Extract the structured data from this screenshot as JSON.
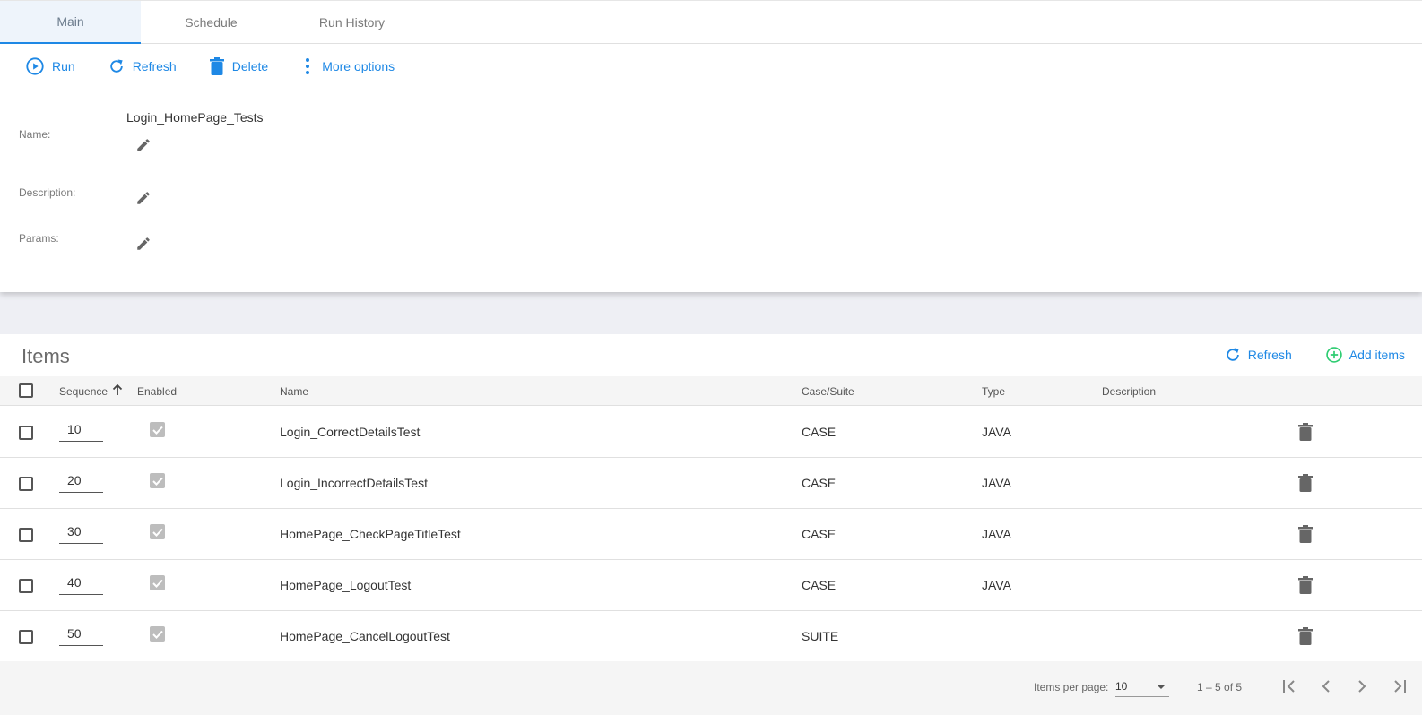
{
  "tabs": [
    {
      "label": "Main"
    },
    {
      "label": "Schedule"
    },
    {
      "label": "Run History"
    }
  ],
  "toolbar": {
    "run_label": "Run",
    "refresh_label": "Refresh",
    "delete_label": "Delete",
    "more_label": "More options"
  },
  "details": {
    "name_label": "Name:",
    "name_value": "Login_HomePage_Tests",
    "description_label": "Description:",
    "params_label": "Params:"
  },
  "items": {
    "title": "Items",
    "refresh_label": "Refresh",
    "add_label": "Add items",
    "columns": {
      "sequence": "Sequence",
      "enabled": "Enabled",
      "name": "Name",
      "case_suite": "Case/Suite",
      "type": "Type",
      "description": "Description"
    },
    "rows": [
      {
        "sequence": "10",
        "enabled": true,
        "name": "Login_CorrectDetailsTest",
        "case_suite": "CASE",
        "type": "JAVA",
        "description": ""
      },
      {
        "sequence": "20",
        "enabled": true,
        "name": "Login_IncorrectDetailsTest",
        "case_suite": "CASE",
        "type": "JAVA",
        "description": ""
      },
      {
        "sequence": "30",
        "enabled": true,
        "name": "HomePage_CheckPageTitleTest",
        "case_suite": "CASE",
        "type": "JAVA",
        "description": ""
      },
      {
        "sequence": "40",
        "enabled": true,
        "name": "HomePage_LogoutTest",
        "case_suite": "CASE",
        "type": "JAVA",
        "description": ""
      },
      {
        "sequence": "50",
        "enabled": true,
        "name": "HomePage_CancelLogoutTest",
        "case_suite": "SUITE",
        "type": "",
        "description": ""
      }
    ]
  },
  "paginator": {
    "items_per_page_label": "Items per page:",
    "items_per_page_value": "10",
    "range_label": "1 – 5 of 5"
  },
  "colors": {
    "accent": "#1e88e5",
    "add_green": "#2ecc71",
    "muted": "#7a7a7a"
  }
}
